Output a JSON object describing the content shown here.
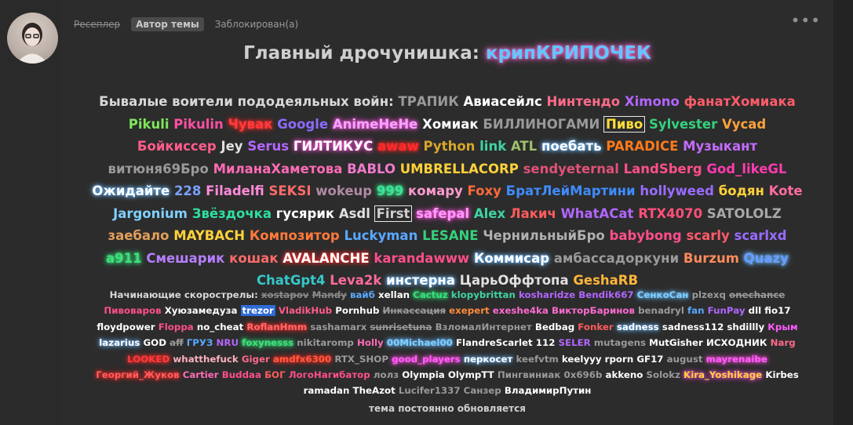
{
  "post": {
    "user_group": "Ресеплер",
    "badge": "Автор темы",
    "status": "Заблокирован(а)",
    "menu_icon": "more-icon",
    "title_prefix": "Главный дрочунишка:",
    "title_name": "крипКРИПОЧЕК",
    "veterans_label": "Бывалые воители пододеяльных войн:",
    "newbies_label": "Начинающие скорострелы:",
    "footer": "тема постоянно обновляется"
  },
  "veterans": [
    {
      "t": "ТРАПИК",
      "c": "#9a9a9a"
    },
    {
      "t": "Авиасейлс",
      "c": "#ffffff"
    },
    {
      "t": "Нинтендо",
      "c": "#ff6b8b"
    },
    {
      "t": "Ximono",
      "c": "#b266ff"
    },
    {
      "t": "фанатХомиака",
      "c": "#ff5c6a"
    },
    {
      "t": "Pikuli",
      "c": "#7ee65a"
    },
    {
      "t": "Pikulin",
      "c": "#ff4fa3"
    },
    {
      "t": "Чувак",
      "c": "#ff3b3b",
      "s": "glow-red"
    },
    {
      "t": "Google",
      "c": "#8a6bff"
    },
    {
      "t": "AnimeHeHe",
      "c": "#f0a6ff",
      "s": "glow-pink"
    },
    {
      "t": "Хомиак",
      "c": "#ffffff"
    },
    {
      "t": "БИЛЛИНОГАМИ",
      "c": "#9a9a9a"
    },
    {
      "t": "Пиво",
      "c": "#ffdf3a",
      "s": "box"
    },
    {
      "t": "Sylvester",
      "c": "#35d07c"
    },
    {
      "t": "Vycad",
      "c": "#ffa23c"
    },
    {
      "t": "Бойкиссер",
      "c": "#ff5c8a"
    },
    {
      "t": "Jey",
      "c": "#e0e0e0"
    },
    {
      "t": "Serus",
      "c": "#b266ff"
    },
    {
      "t": "ГИЛТИКУС",
      "c": "#ffffff",
      "s": "glow-pink"
    },
    {
      "t": "awaw",
      "c": "#ff2a2a",
      "s": "glow-red"
    },
    {
      "t": "Python",
      "c": "#d8a62a"
    },
    {
      "t": "link",
      "c": "#3fd3a3"
    },
    {
      "t": "ATL",
      "c": "#9fbf6a"
    },
    {
      "t": "поебать",
      "c": "#ffffff",
      "s": "glow-blue"
    },
    {
      "t": "PARADICE",
      "c": "#ff7a1a"
    },
    {
      "t": "Музыкант",
      "c": "#c56bff"
    },
    {
      "t": "витюня69Бро",
      "c": "#9a9a9a"
    },
    {
      "t": "МиланаХаметова",
      "c": "#ff6bb5"
    },
    {
      "t": "BABLO",
      "c": "#f07acb"
    },
    {
      "t": "UMBRELLACORP",
      "c": "#ffd23a"
    },
    {
      "t": "sendyeternal",
      "c": "#e0517a"
    },
    {
      "t": "LandSberg",
      "c": "#ff4f8b"
    },
    {
      "t": "God_likeGL",
      "c": "#ff3bb0"
    },
    {
      "t": "Ожидайте",
      "c": "#ffffff",
      "s": "glow-blue"
    },
    {
      "t": "228",
      "c": "#7aa0ff"
    },
    {
      "t": "Filadelfi",
      "c": "#ff8bd9"
    },
    {
      "t": "SEKSI",
      "c": "#ff6b6b"
    },
    {
      "t": "wokeup",
      "c": "#b08aa5"
    },
    {
      "t": "999",
      "c": "#3fe0a0",
      "s": "glow-green"
    },
    {
      "t": "комару",
      "c": "#ff9ad0"
    },
    {
      "t": "Foxy",
      "c": "#ff6a3b"
    },
    {
      "t": "БратЛейМартини",
      "c": "#3f8cff"
    },
    {
      "t": "hollyweed",
      "c": "#9a6bff"
    },
    {
      "t": "бодян",
      "c": "#ffd23a"
    },
    {
      "t": "Kote",
      "c": "#ff6ba0"
    },
    {
      "t": "Jargonium",
      "c": "#7fd0ff"
    },
    {
      "t": "Звёздочка",
      "c": "#2ee0a0"
    },
    {
      "t": "гусярик",
      "c": "#ffffff"
    },
    {
      "t": "Asdl",
      "c": "#e0e0e0"
    },
    {
      "t": "First",
      "c": "#cfcfcf",
      "s": "box"
    },
    {
      "t": "safepal",
      "c": "#ff9bff",
      "s": "glow-pink"
    },
    {
      "t": "Alex",
      "c": "#3fd3a3"
    },
    {
      "t": "Лакич",
      "c": "#ff5c5c"
    },
    {
      "t": "WhatACat",
      "c": "#b266ff"
    },
    {
      "t": "RTX4070",
      "c": "#ff4f7a"
    },
    {
      "t": "SATOLOLZ",
      "c": "#a8a8a8"
    },
    {
      "t": "заебало",
      "c": "#e2a05a"
    },
    {
      "t": "MAYBACH",
      "c": "#ffd23a"
    },
    {
      "t": "Композитор",
      "c": "#ff7a3b"
    },
    {
      "t": "Luckyman",
      "c": "#5aa8ff"
    },
    {
      "t": "LESANE",
      "c": "#35d07c"
    },
    {
      "t": "ЧернильныйБро",
      "c": "#b0b0b0"
    },
    {
      "t": "babybong",
      "c": "#ff4f8b"
    },
    {
      "t": "scarly",
      "c": "#ff5a6a"
    },
    {
      "t": "scarlxd",
      "c": "#9a6bff"
    },
    {
      "t": "a911",
      "c": "#3fe07a",
      "s": "glow-green"
    },
    {
      "t": "Смешарик",
      "c": "#b67fff"
    },
    {
      "t": "кошак",
      "c": "#ff6a6a"
    },
    {
      "t": "AVALANCHE",
      "c": "#ffffff",
      "s": "glow-red"
    },
    {
      "t": "karandawww",
      "c": "#ff4f8b"
    },
    {
      "t": "Коммисар",
      "c": "#ffffff",
      "s": "glow-blue"
    },
    {
      "t": "амбассадоркуни",
      "c": "#9a9a9a"
    },
    {
      "t": "Burzum",
      "c": "#ff8b5a"
    },
    {
      "t": "Quazy",
      "c": "#6b9cff",
      "s": "glow-blue"
    },
    {
      "t": "ChatGpt4",
      "c": "#35c8c8"
    },
    {
      "t": "Leva2k",
      "c": "#ff6b9a"
    },
    {
      "t": "инстерна",
      "c": "#ffffff",
      "s": "glow-blue"
    },
    {
      "t": "ЦарьОффтопа",
      "c": "#e0e0e0"
    },
    {
      "t": "GeshaRB",
      "c": "#ffb63a"
    }
  ],
  "newbies": [
    {
      "t": "xostapov",
      "c": "#8a8a8a",
      "s": "strike"
    },
    {
      "t": "Mandy",
      "c": "#8a8a8a",
      "s": "strike"
    },
    {
      "t": "вайб",
      "c": "#5aa8ff"
    },
    {
      "t": "xellan",
      "c": "#ffffff"
    },
    {
      "t": "Cactuz",
      "c": "#35e07a",
      "s": "glow-green"
    },
    {
      "t": "klopybrittan",
      "c": "#3fd3a3"
    },
    {
      "t": "kosharidze",
      "c": "#b266ff"
    },
    {
      "t": "Bendik667",
      "c": "#b266ff"
    },
    {
      "t": "СенкоСан",
      "c": "#7fd0ff",
      "s": "glow-blue"
    },
    {
      "t": "plzexq",
      "c": "#9a9a9a"
    },
    {
      "t": "onechance",
      "c": "#9a9a9a",
      "s": "strike"
    },
    {
      "t": "Пивоваров",
      "c": "#ff4f8b"
    },
    {
      "t": "Хуюзамедуза",
      "c": "#ffffff"
    },
    {
      "t": "trezor",
      "c": "#ffffff",
      "s": "box-blue"
    },
    {
      "t": "VladikHub",
      "c": "#ff5c8a"
    },
    {
      "t": "Pornhub",
      "c": "#ffffff"
    },
    {
      "t": "Инкассация",
      "c": "#9a9a9a",
      "s": "strike"
    },
    {
      "t": "exepert",
      "c": "#ff8b3b"
    },
    {
      "t": "exeshe4ka",
      "c": "#ff6bd0"
    },
    {
      "t": "ВикторБаринов",
      "c": "#ff6bd0"
    },
    {
      "t": "benadryl",
      "c": "#9a9a9a"
    },
    {
      "t": "fan",
      "c": "#5aa8ff"
    },
    {
      "t": "FunPay",
      "c": "#b266ff"
    },
    {
      "t": "dll",
      "c": "#ffffff"
    },
    {
      "t": "fio17",
      "c": "#ffffff"
    },
    {
      "t": "floydpower",
      "c": "#ffffff"
    },
    {
      "t": "Floppa",
      "c": "#ff4f8b"
    },
    {
      "t": "no_cheat",
      "c": "#ffffff"
    },
    {
      "t": "RoflanHmm",
      "c": "#ff6a6a",
      "s": "glow-red"
    },
    {
      "t": "sashamarx",
      "c": "#9a9a9a"
    },
    {
      "t": "sunrisetuna",
      "c": "#9a9a9a",
      "s": "strike"
    },
    {
      "t": "ВзломалИнтернет",
      "c": "#9a9a9a"
    },
    {
      "t": "Bedbag",
      "c": "#ffffff"
    },
    {
      "t": "Fonker",
      "c": "#ff5c5c"
    },
    {
      "t": "sadness",
      "c": "#ffffff",
      "s": "glow-blue"
    },
    {
      "t": "sadness112",
      "c": "#ffffff"
    },
    {
      "t": "shdillly",
      "c": "#ffffff"
    },
    {
      "t": "Крым",
      "c": "#ff5cff"
    },
    {
      "t": "lazarius",
      "c": "#ffffff",
      "s": "glow-blue"
    },
    {
      "t": "GOD",
      "c": "#ffffff"
    },
    {
      "t": "aff",
      "c": "#9a9a9a",
      "s": "strike"
    },
    {
      "t": "ГРУЗ",
      "c": "#5aa8ff"
    },
    {
      "t": "NRU",
      "c": "#b266ff"
    },
    {
      "t": "foxynesss",
      "c": "#3fe07a",
      "s": "glow-green"
    },
    {
      "t": "nikitaromp",
      "c": "#9a9a9a"
    },
    {
      "t": "Holly",
      "c": "#ff6bb5"
    },
    {
      "t": "00Michael00",
      "c": "#7fd0ff",
      "s": "glow-blue"
    },
    {
      "t": "FlandreScarlet",
      "c": "#ffffff"
    },
    {
      "t": "112",
      "c": "#ffffff"
    },
    {
      "t": "SELER",
      "c": "#b266ff"
    },
    {
      "t": "mutagens",
      "c": "#9a9a9a"
    },
    {
      "t": "MutGisher",
      "c": "#ffffff"
    },
    {
      "t": "ИСХОДНИК",
      "c": "#ffffff"
    },
    {
      "t": "Narg",
      "c": "#ff6a8a"
    },
    {
      "t": "LOOKED",
      "c": "#ff3b3b",
      "s": "glow-red"
    },
    {
      "t": "whatthefuck",
      "c": "#ffb0c0"
    },
    {
      "t": "Giger",
      "c": "#ff6a8a"
    },
    {
      "t": "amdfx6300",
      "c": "#ff5c3b",
      "s": "glow-red"
    },
    {
      "t": "RTX_SHOP",
      "c": "#9a9a9a"
    },
    {
      "t": "good_players",
      "c": "#ff5cff",
      "s": "glow-pink"
    },
    {
      "t": "перкосет",
      "c": "#ffffff",
      "s": "glow-blue"
    },
    {
      "t": "keefvtm",
      "c": "#9a9a9a"
    },
    {
      "t": "keelyyy",
      "c": "#ffffff"
    },
    {
      "t": "rporn",
      "c": "#ffffff"
    },
    {
      "t": "GF17",
      "c": "#ffffff"
    },
    {
      "t": "august",
      "c": "#9a9a9a"
    },
    {
      "t": "mayrenaibe",
      "c": "#ff5cff",
      "s": "glow-pink"
    },
    {
      "t": "Георгий_Жуков",
      "c": "#ff5c5c",
      "s": "glow-red"
    },
    {
      "t": "Cartier",
      "c": "#ff6bb5"
    },
    {
      "t": "Buddaa",
      "c": "#ff4f8b"
    },
    {
      "t": "БОГ",
      "c": "#ff5c5c"
    },
    {
      "t": "ЛогоНагибатор",
      "c": "#ff4f8b"
    },
    {
      "t": "лолз",
      "c": "#9a9a9a"
    },
    {
      "t": "Olympia",
      "c": "#ffffff"
    },
    {
      "t": "OlympTT",
      "c": "#ffffff"
    },
    {
      "t": "Пингвиниак",
      "c": "#9a9a9a"
    },
    {
      "t": "0x696b",
      "c": "#9a9a9a"
    },
    {
      "t": "akkeno",
      "c": "#ffffff"
    },
    {
      "t": "Solokz",
      "c": "#9a9a9a"
    },
    {
      "t": "Kira_Yoshikage",
      "c": "#ffd23a",
      "s": "glow-pink"
    },
    {
      "t": "Kirbes",
      "c": "#ffffff"
    },
    {
      "t": "ramadan",
      "c": "#ffffff"
    },
    {
      "t": "TheAzot",
      "c": "#ffffff"
    },
    {
      "t": "Lucifer1337",
      "c": "#9a9a9a"
    },
    {
      "t": "Санзер",
      "c": "#9a9a9a"
    },
    {
      "t": "ВладимирПутин",
      "c": "#ffffff"
    }
  ]
}
